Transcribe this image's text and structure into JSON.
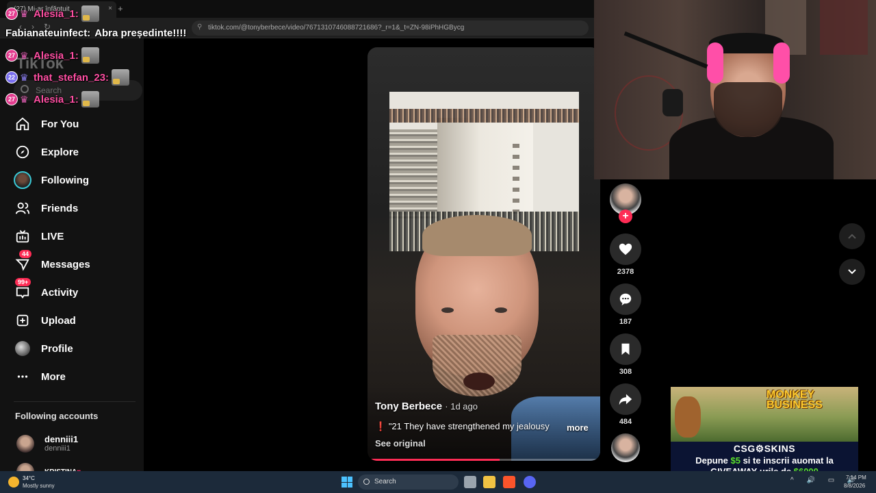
{
  "browser": {
    "tab_title": "(27) Mi-ar înfăptuit",
    "tab_close": "×",
    "new_tab": "+",
    "url": "tiktok.com/@tonyberbece/video/7671310746088721686?_r=1&_t=ZN-98iPhHGBycg"
  },
  "chat": [
    {
      "level": "27",
      "user": "Alesia_1:",
      "msg": "",
      "emote": true
    },
    {
      "level": "",
      "user": "Fabianateuinfect:",
      "msg": "Abra președinte!!!!",
      "emote": false
    },
    {
      "level": "27",
      "user": "Alesia_1:",
      "msg": "",
      "emote": true
    },
    {
      "level": "22",
      "user": "that_stefan_23:",
      "msg": "",
      "emote": true
    },
    {
      "level": "27",
      "user": "Alesia_1:",
      "msg": "",
      "emote": true
    }
  ],
  "sidebar": {
    "logo": "TikTok",
    "search_placeholder": "Search",
    "items": [
      {
        "label": "For You",
        "icon": "home-icon"
      },
      {
        "label": "Explore",
        "icon": "compass-icon"
      },
      {
        "label": "Following",
        "icon": "following-avatar"
      },
      {
        "label": "Friends",
        "icon": "friends-icon"
      },
      {
        "label": "LIVE",
        "icon": "live-tv-icon"
      },
      {
        "label": "Messages",
        "icon": "messages-icon",
        "badge": "44"
      },
      {
        "label": "Activity",
        "icon": "activity-icon",
        "badge": "99+"
      },
      {
        "label": "Upload",
        "icon": "upload-icon"
      },
      {
        "label": "Profile",
        "icon": "profile-avatar"
      },
      {
        "label": "More",
        "icon": "more-dots-icon"
      }
    ],
    "following_title": "Following accounts",
    "accounts": [
      {
        "name": "denniii1",
        "handle": "denniii1"
      },
      {
        "name": "KRISTINA",
        "handle": ""
      }
    ]
  },
  "video": {
    "author": "Tony Berbece",
    "time": "1d ago",
    "caption": "\"21 They have strengthened my jealousy",
    "caption_mark": "❗",
    "more": "more",
    "see_original": "See original",
    "progress": 0.57
  },
  "actions": {
    "likes": "2378",
    "comments": "187",
    "saves": "308",
    "shares": "484",
    "follow_plus": "+"
  },
  "ad": {
    "game_title": "MONKEY BUSINESS",
    "brand": "CSG⚙SKINS",
    "line1_a": "Depune ",
    "line1_amount": "$5",
    "line1_b": " si te inscrii auomat la",
    "line2_a": "GIVEAWAY-urile de ",
    "line2_amount": "$6000"
  },
  "taskbar": {
    "temp": "34°C",
    "weather": "Mostly sunny",
    "search": "Search",
    "time": "7:14 PM",
    "date": "8/8/2026",
    "tray": "^ 🔊 ▭ 🔊"
  },
  "colors": {
    "accent": "#fe2c55",
    "following_ring": "#3ac9d6",
    "chat_user": "#ff4fa3"
  }
}
